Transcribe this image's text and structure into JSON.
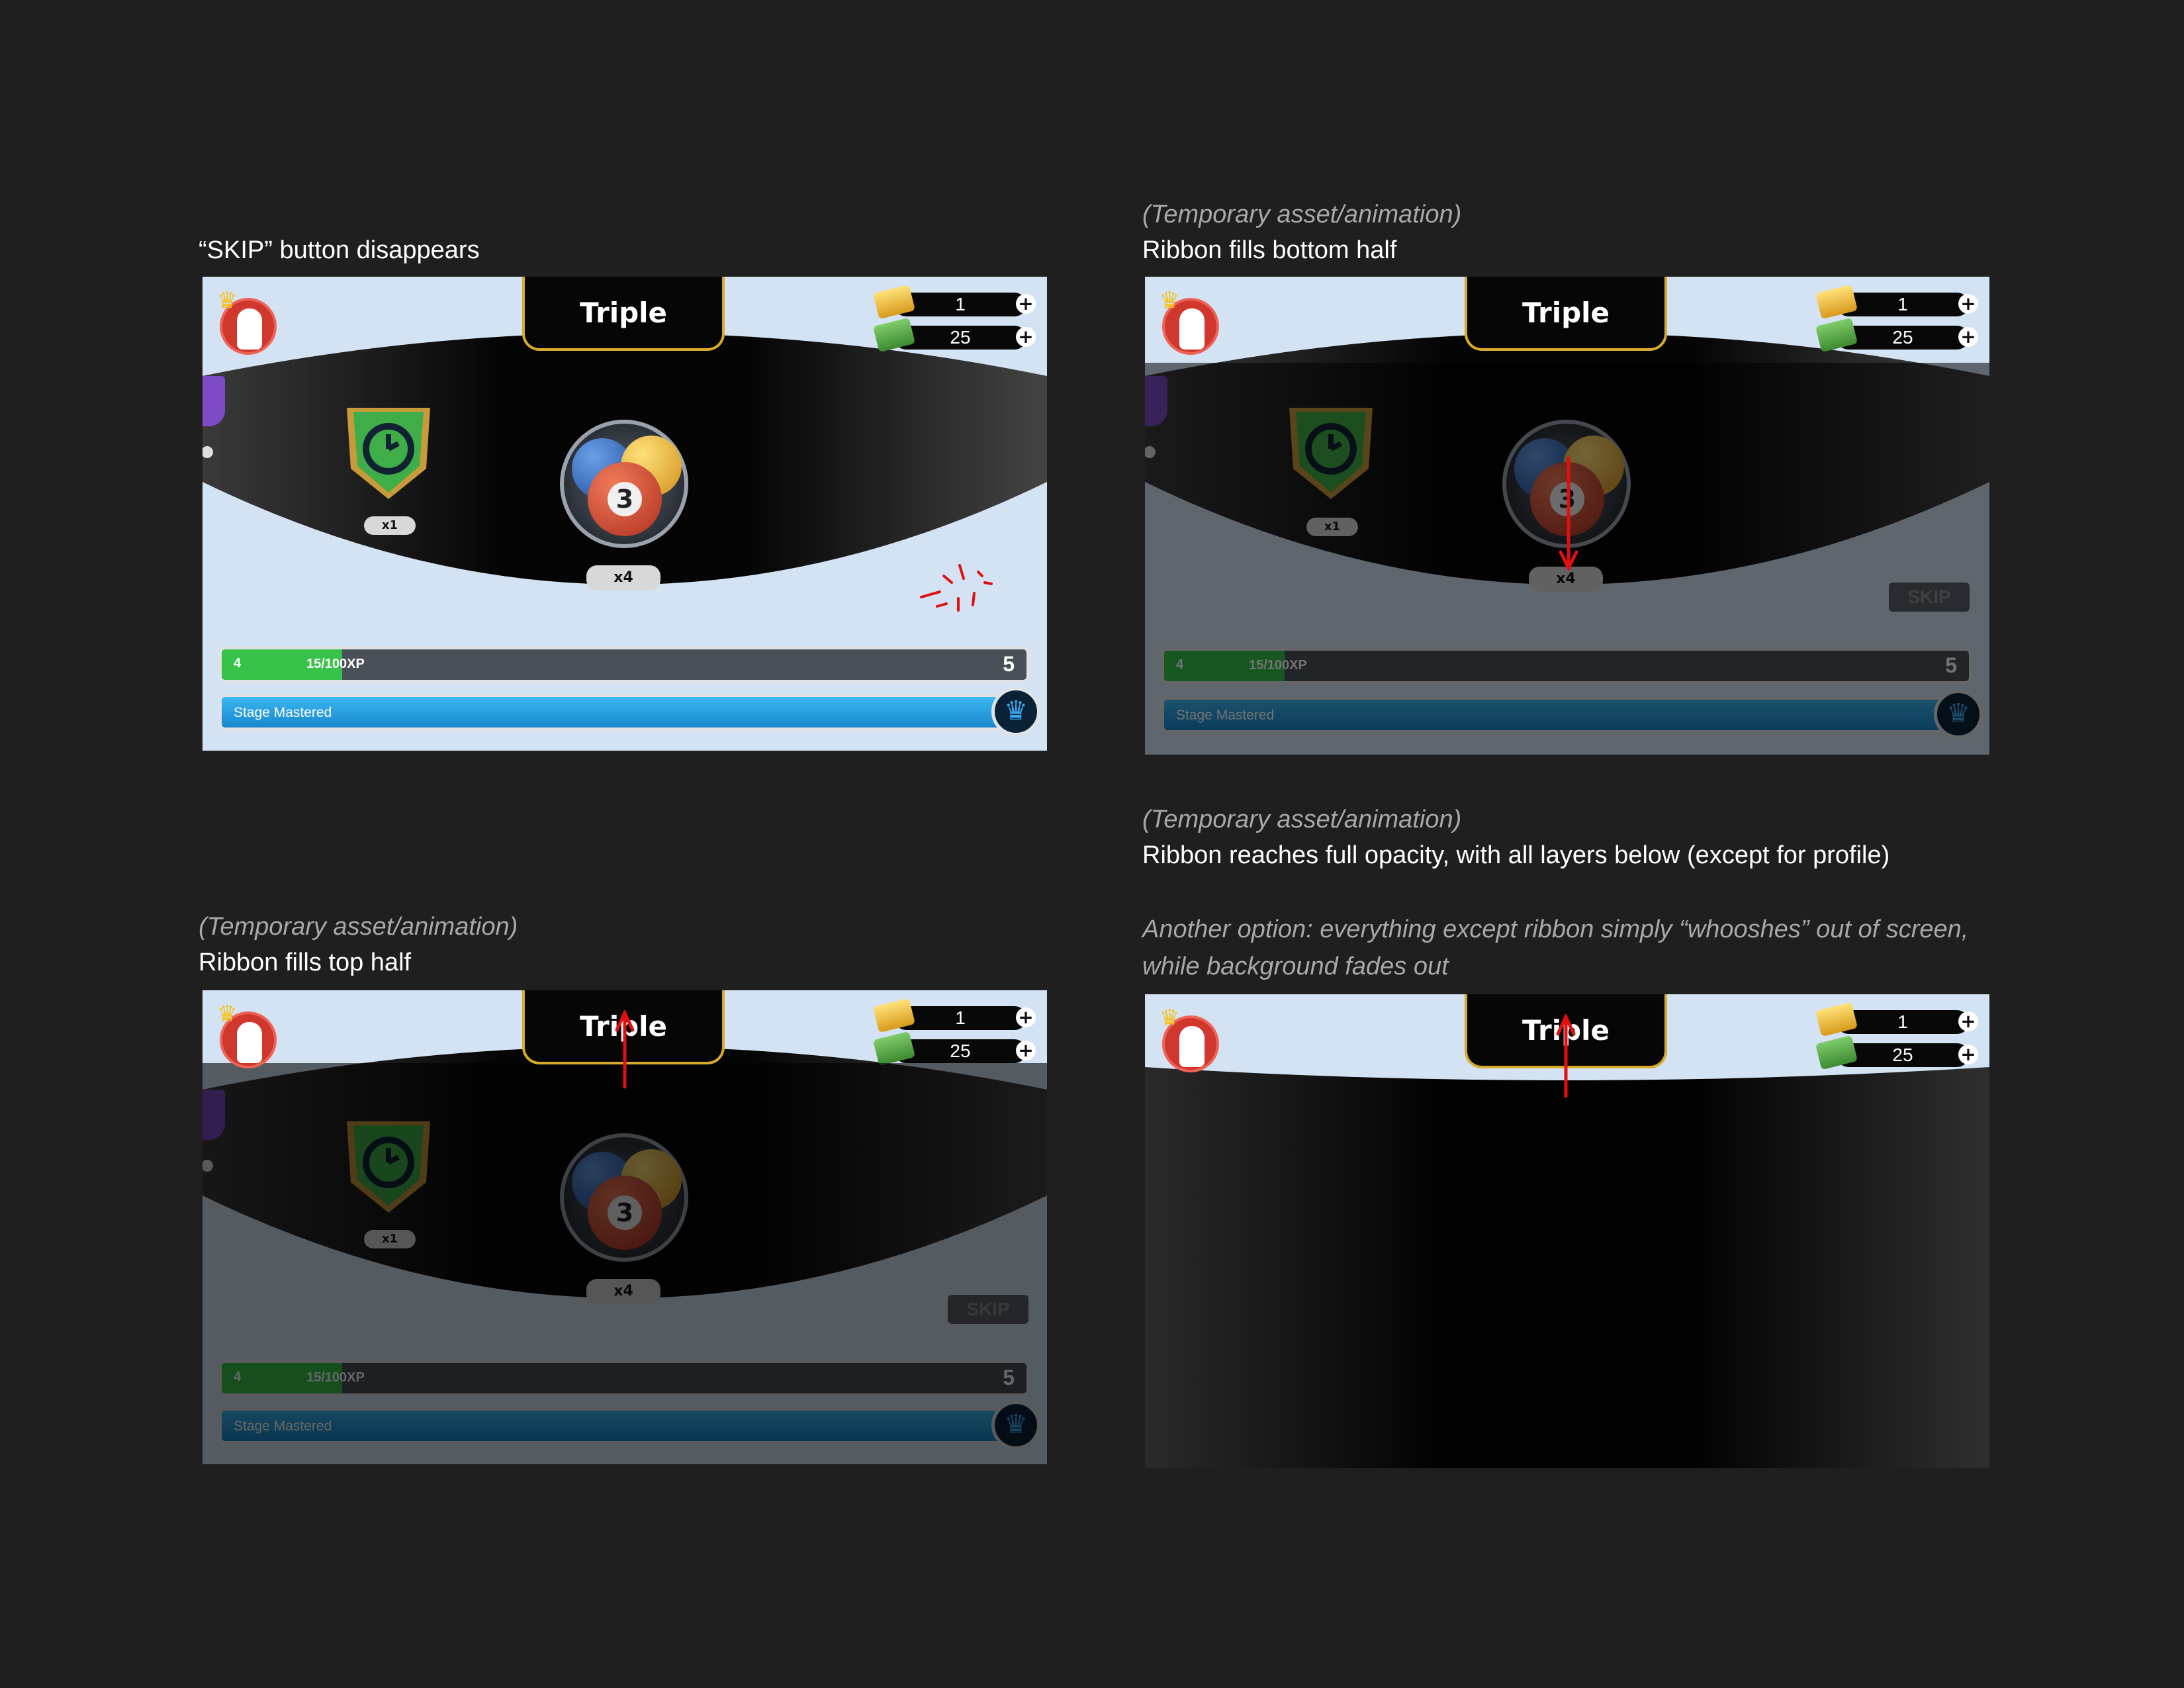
{
  "captions": {
    "p1_title": "“SKIP” button disappears",
    "p2_note": "(Temporary asset/animation)",
    "p2_title": "Ribbon fills bottom half",
    "p3_note": "(Temporary asset/animation)",
    "p3_title": "Ribbon fills top half",
    "p4_note": "(Temporary asset/animation)",
    "p4_title": "Ribbon reaches full opacity, with all layers below (except for profile)",
    "p4_alt_line1": "Another option: everything except ribbon simply “whooshes” out of screen,",
    "p4_alt_line2": "while background fades out"
  },
  "screen": {
    "title": "Triple",
    "currency_gold": "1",
    "currency_cash": "25",
    "reward_shield_count": "x1",
    "reward_balls_count": "x4",
    "ball_number": "3",
    "skip_label": "SKIP",
    "xp_level_current": "4",
    "xp_text": "15/100XP",
    "xp_level_next": "5",
    "xp_progress": 0.15,
    "stage_label": "Stage Mastered"
  },
  "colors": {
    "page_bg": "#1f1f1f",
    "accent_gold": "#d8aa2a",
    "xp_green": "#37c24a",
    "stage_blue": "#1f9be0",
    "annotation_red": "#e01010"
  }
}
